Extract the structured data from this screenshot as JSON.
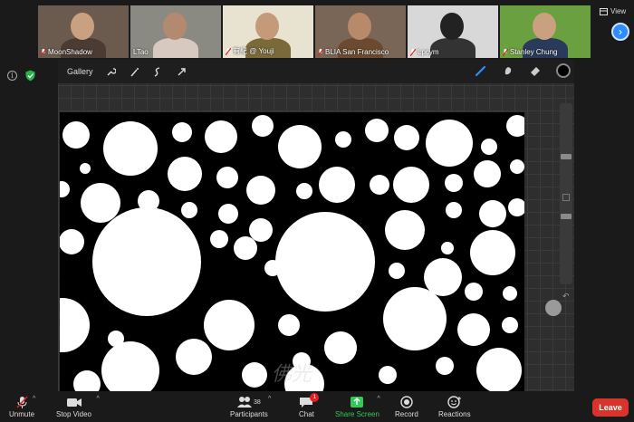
{
  "participants_strip": [
    {
      "name": "MoonShadow",
      "muted": true,
      "bg": "#6b5a4e",
      "skin": "#c9a080",
      "shirt": "#4a3b33"
    },
    {
      "name": "LTao",
      "muted": false,
      "bg": "#8a8a82",
      "skin": "#b38a70",
      "shirt": "#d8c9c0"
    },
    {
      "name": "有紀 @ Youji",
      "muted": true,
      "bg": "#e8e2d0",
      "skin": "#c49a7a",
      "shirt": "#7a6a3a",
      "active": true
    },
    {
      "name": "BLIA San Francisco",
      "muted": true,
      "bg": "#7a6656",
      "skin": "#b88a6a",
      "shirt": "#6b4a30"
    },
    {
      "name": "Lpcym",
      "muted": true,
      "bg": "#d8d8d8",
      "skin": "#222222",
      "shirt": "#333333"
    },
    {
      "name": "Stanley Chung",
      "muted": true,
      "bg": "#6aa040",
      "skin": "#c9a080",
      "shirt": "#2a3a5a"
    }
  ],
  "view_label": "View",
  "procreate": {
    "gallery_label": "Gallery",
    "tools": [
      "wrench-icon",
      "magic-wand-icon",
      "selection-icon",
      "transform-arrow-icon"
    ],
    "brush_color": "#000000"
  },
  "toolbar": {
    "unmute": "Unmute",
    "stop_video": "Stop Video",
    "participants": "Participants",
    "participants_count": "38",
    "chat": "Chat",
    "chat_badge": "1",
    "share_screen": "Share Screen",
    "record": "Record",
    "reactions": "Reactions",
    "leave": "Leave"
  },
  "colors": {
    "accent_blue": "#2d8cff",
    "share_green": "#34c759",
    "leave_red": "#d9342b",
    "active_speaker": "#f2d94c"
  }
}
